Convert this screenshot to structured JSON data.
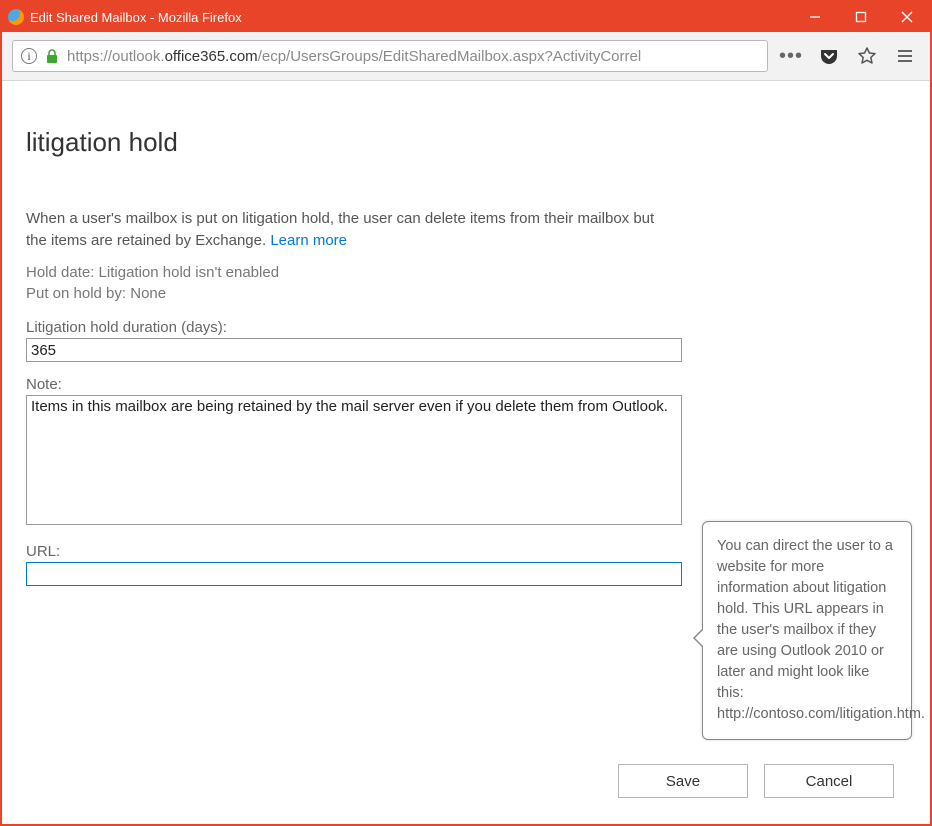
{
  "window": {
    "title": "Edit Shared Mailbox - Mozilla Firefox"
  },
  "addressbar": {
    "url_prefix": "https://outlook.",
    "url_bold": "office365.com",
    "url_suffix": "/ecp/UsersGroups/EditSharedMailbox.aspx?ActivityCorrel"
  },
  "page": {
    "title": "litigation hold",
    "intro": "When a user's mailbox is put on litigation hold, the user can delete items from their mailbox but the items are retained by Exchange. ",
    "learn_more": "Learn more",
    "hold_date_line": "Hold date: Litigation hold isn't enabled",
    "put_on_hold_line": "Put on hold by: None",
    "duration_label": "Litigation hold duration (days):",
    "duration_value": "365",
    "note_label": "Note:",
    "note_value": "Items in this mailbox are being retained by the mail server even if you delete them from Outlook.",
    "url_label": "URL:",
    "url_value": "",
    "tooltip_text": "You can direct the user to a website for more information about litigation hold. This URL appears in the user's mailbox if they are using Outlook 2010 or later and might look like this: http://contoso.com/litigation.htm."
  },
  "buttons": {
    "save": "Save",
    "cancel": "Cancel"
  }
}
